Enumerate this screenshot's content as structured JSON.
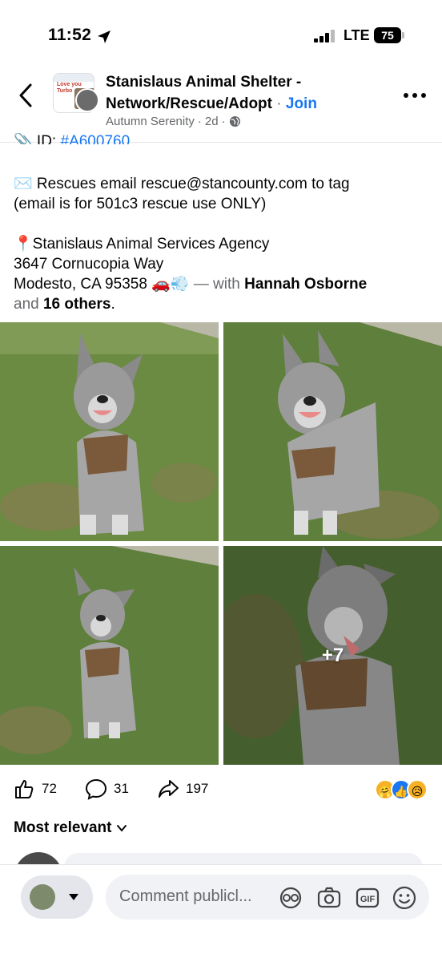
{
  "status_bar": {
    "time": "11:52",
    "carrier": "LTE",
    "battery": "75"
  },
  "header": {
    "group_name_line1": "Stanislaus Animal Shelter -",
    "group_name_line2": "Network/Rescue/Adopt",
    "separator": " · ",
    "join_label": "Join",
    "author": "Autumn Serenity",
    "dot": "·",
    "posted": "2d",
    "dot2": "·",
    "avatar_text": "Love you Turbo"
  },
  "post": {
    "id_prefix": "📎 ID: ",
    "id_value": "#A600760",
    "email_line1": "✉️ Rescues email rescue@stancounty.com to tag",
    "email_line2": "(email is for 501c3 rescue use ONLY)",
    "location_line1": "📍Stanislaus Animal Services Agency",
    "location_line2": "3647 Cornucopia Way",
    "location_line3_prefix": "Modesto, CA 95358 🚗💨",
    "with_text": " — with ",
    "tagged_person": "Hannah Osborne",
    "and_text": "and ",
    "others": "16 others",
    "period": "."
  },
  "photos": {
    "more_count": "+7"
  },
  "reactions": {
    "likes": "72",
    "comments": "31",
    "shares": "197"
  },
  "comments_sort": {
    "label": "Most relevant"
  },
  "composer": {
    "placeholder": "Comment publicl..."
  },
  "colors": {
    "facebook_blue": "#1877f2",
    "muted_text": "#65676b",
    "grass": "#5d7a3a"
  }
}
